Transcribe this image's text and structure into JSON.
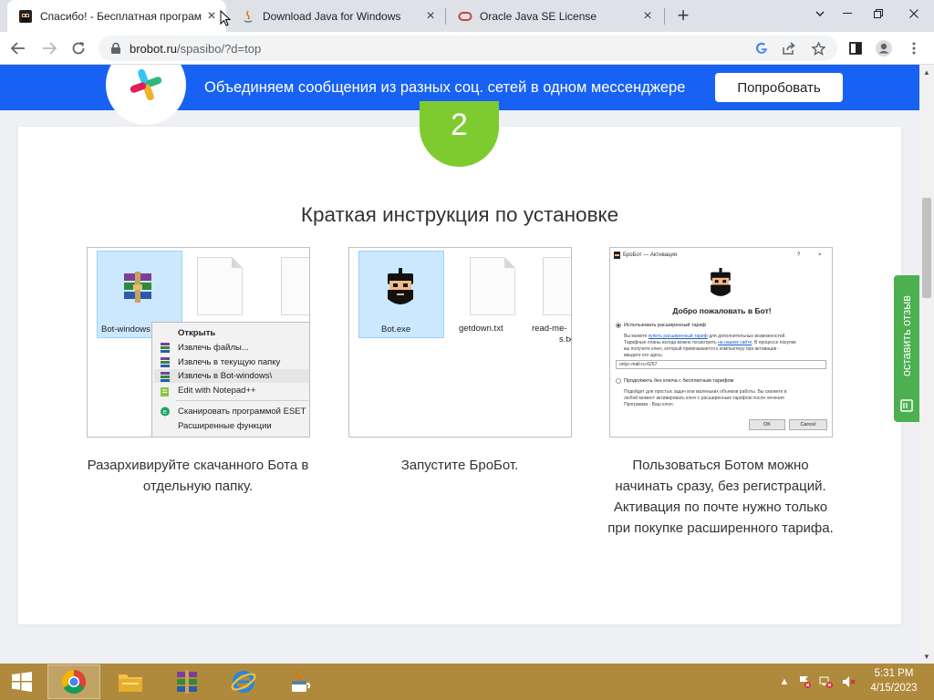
{
  "browser": {
    "tabs": [
      {
        "title": "Спасибо! - Бесплатная програм",
        "active": true
      },
      {
        "title": "Download Java for Windows",
        "active": false
      },
      {
        "title": "Oracle Java SE License",
        "active": false
      }
    ],
    "url_host": "brobot.ru",
    "url_path": "/spasibo/?d=top"
  },
  "banner": {
    "text": "Объединяем сообщения из разных соц. сетей в одном мессенджере",
    "button_label": "Попробовать"
  },
  "step": {
    "number": "2",
    "title": "Краткая инструкция по установке"
  },
  "shot1": {
    "file_selected": "Bot-windows",
    "context_menu": [
      "Открыть",
      "Извлечь файлы...",
      "Извлечь в текущую папку",
      "Извлечь в Bot-windows\\",
      "Edit with Notepad++",
      "Сканировать программой ESET",
      "Расширенные функции"
    ]
  },
  "shot2": {
    "files": [
      "Bot.exe",
      "getdown.txt",
      "read-me-",
      "s.tx"
    ]
  },
  "shot3": {
    "title": "БроБот — Активация",
    "help": "?",
    "close": "×",
    "heading": "Добро пожаловать в Бот!",
    "option1": "Использовать расширенный тариф",
    "option1_desc_a": "Вы можете",
    "option1_link": "купить расширенный тариф",
    "option1_desc_b": "для дополнительных возможностей.",
    "option1_desc_c": "Тарифные планы всегда можно посмотреть",
    "option1_link2": "на нашем сайте",
    "option1_desc_d": ". В процессе покупки",
    "option1_desc_e": "вы получите ключ, который привязывается к компьютеру при активации -",
    "option1_desc_f": "введите его здесь:",
    "key_value": "onlyc-mail-ru-6267",
    "option2": "Продолжить без ключа с бесплатным тарифом",
    "option2_desc_a": "Подойдет для простых задач или маленьких объемов работы. Вы сможете в",
    "option2_desc_b": "любой момент активировать ключ с расширенным тарифом после лечения",
    "option2_desc_c": "Программа - Ваш ключ.",
    "ok": "OK",
    "cancel": "Cancel"
  },
  "captions": [
    "Разархивируйте скачанного Бота в отдельную папку.",
    "Запустите БроБот.",
    "Пользоваться Ботом можно начинать сразу, без регистраций. Активация по почте нужно только при покупке расширенного тарифа."
  ],
  "feedback_label": "оставить отзыв",
  "taskbar": {
    "time": "5:31 PM",
    "date": "4/15/2023"
  },
  "colors": {
    "banner": "#1862f3",
    "step": "#7ecb2f",
    "feedback": "#4caf50",
    "taskbar": "#b08a3c"
  }
}
